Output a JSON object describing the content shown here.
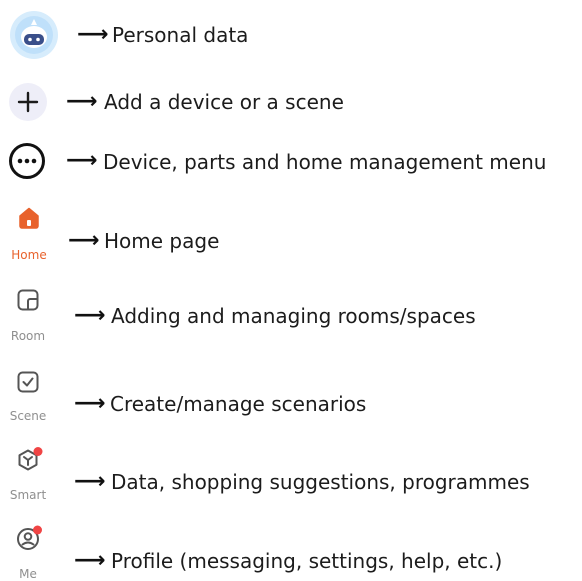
{
  "legend": {
    "items": [
      {
        "icon": "avatar-icon",
        "description": "Personal data"
      },
      {
        "icon": "plus-icon",
        "description": "Add a device or a scene"
      },
      {
        "icon": "more-icon",
        "description": "Device, parts and home management menu"
      },
      {
        "icon": "home-icon",
        "tab_label": "Home",
        "description": "Home page"
      },
      {
        "icon": "room-icon",
        "tab_label": "Room",
        "description": "Adding and managing rooms/spaces"
      },
      {
        "icon": "scene-icon",
        "tab_label": "Scene",
        "description": "Create/manage scenarios"
      },
      {
        "icon": "smart-icon",
        "tab_label": "Smart",
        "description": "Data, shopping suggestions, programmes"
      },
      {
        "icon": "me-icon",
        "tab_label": "Me",
        "description": "Profile (messaging, settings, help, etc.)"
      }
    ]
  },
  "colors": {
    "accent": "#e8622c",
    "notification_dot": "#f04444",
    "icon_gray": "#595959",
    "tab_label_gray": "#8f8f8f",
    "avatar_bg": "#cfe8fb"
  }
}
